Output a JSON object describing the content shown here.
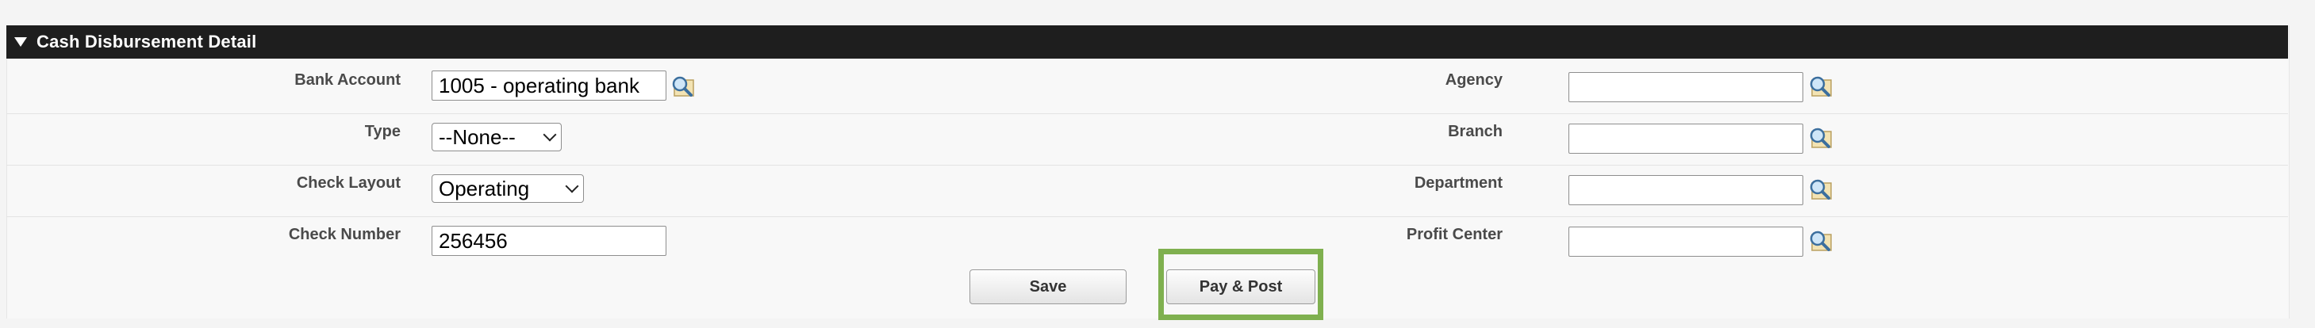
{
  "section": {
    "title": "Cash Disbursement Detail"
  },
  "fields": {
    "bank_account": {
      "label": "Bank Account",
      "value": "1005 - operating bank"
    },
    "type": {
      "label": "Type",
      "value": "--None--"
    },
    "check_layout": {
      "label": "Check Layout",
      "value": "Operating"
    },
    "check_number": {
      "label": "Check Number",
      "value": "256456"
    },
    "agency": {
      "label": "Agency",
      "value": ""
    },
    "branch": {
      "label": "Branch",
      "value": ""
    },
    "department": {
      "label": "Department",
      "value": ""
    },
    "profit_center": {
      "label": "Profit Center",
      "value": ""
    }
  },
  "buttons": {
    "save": "Save",
    "pay_post": "Pay & Post"
  },
  "colors": {
    "header_bg": "#1e1e1e",
    "highlight": "#7fb04f"
  },
  "icons": {
    "lookup": "magnifier-lookup-icon"
  }
}
